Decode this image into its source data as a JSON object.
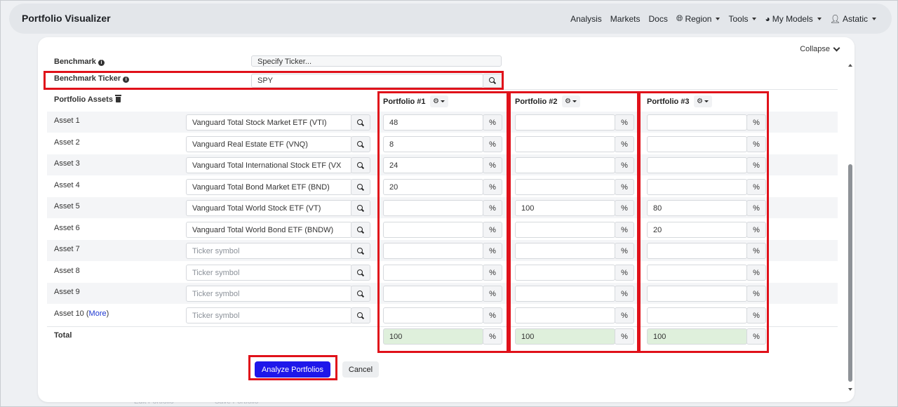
{
  "navbar": {
    "brand": "Portfolio Visualizer",
    "items": [
      "Analysis",
      "Markets",
      "Docs"
    ],
    "region": "Region",
    "tools": "Tools",
    "my_models": "My Models",
    "user": "Astatic"
  },
  "collapse_label": "Collapse",
  "benchmark": {
    "label": "Benchmark",
    "select_value": "Specify Ticker..."
  },
  "benchmark_ticker": {
    "label": "Benchmark Ticker",
    "value": "SPY"
  },
  "portfolio_assets_label": "Portfolio Assets",
  "portfolio_headers": [
    "Portfolio #1",
    "Portfolio #2",
    "Portfolio #3"
  ],
  "percent_symbol": "%",
  "ticker_placeholder": "Ticker symbol",
  "assets": [
    {
      "label": "Asset 1",
      "ticker": "Vanguard Total Stock Market ETF (VTI)",
      "p1": "48",
      "p2": "",
      "p3": ""
    },
    {
      "label": "Asset 2",
      "ticker": "Vanguard Real Estate ETF (VNQ)",
      "p1": "8",
      "p2": "",
      "p3": ""
    },
    {
      "label": "Asset 3",
      "ticker": "Vanguard Total International Stock ETF (VX",
      "p1": "24",
      "p2": "",
      "p3": ""
    },
    {
      "label": "Asset 4",
      "ticker": "Vanguard Total Bond Market ETF (BND)",
      "p1": "20",
      "p2": "",
      "p3": ""
    },
    {
      "label": "Asset 5",
      "ticker": "Vanguard Total World Stock ETF (VT)",
      "p1": "",
      "p2": "100",
      "p3": "80"
    },
    {
      "label": "Asset 6",
      "ticker": "Vanguard Total World Bond ETF (BNDW)",
      "p1": "",
      "p2": "",
      "p3": "20"
    },
    {
      "label": "Asset 7",
      "ticker": "",
      "p1": "",
      "p2": "",
      "p3": ""
    },
    {
      "label": "Asset 8",
      "ticker": "",
      "p1": "",
      "p2": "",
      "p3": ""
    },
    {
      "label": "Asset 9",
      "ticker": "",
      "p1": "",
      "p2": "",
      "p3": ""
    },
    {
      "label": "Asset 10",
      "ticker": "",
      "p1": "",
      "p2": "",
      "p3": ""
    }
  ],
  "more_link": "More",
  "total": {
    "label": "Total",
    "p1": "100",
    "p2": "100",
    "p3": "100"
  },
  "buttons": {
    "analyze": "Analyze Portfolios",
    "cancel": "Cancel"
  },
  "background": {
    "edit_portfolio": "Edit Portfolio",
    "save_portfolio": "Save Portfolio"
  }
}
